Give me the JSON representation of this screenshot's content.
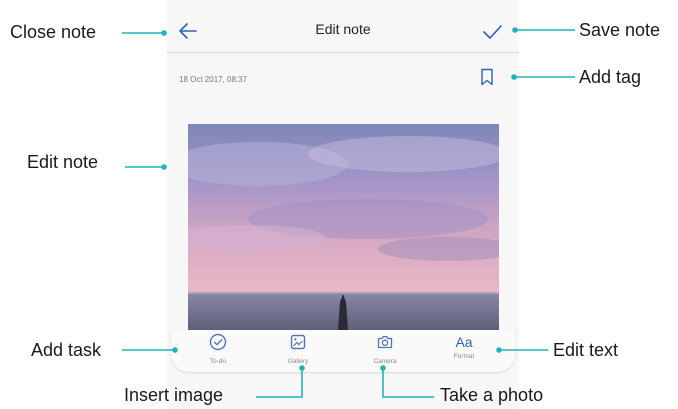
{
  "header": {
    "title": "Edit note",
    "back_icon": "arrow-left-icon",
    "save_icon": "checkmark-icon"
  },
  "note": {
    "timestamp": "18 Oct 2017, 08:37",
    "tag_icon": "bookmark-icon",
    "image": "sunset-sea-photo"
  },
  "toolbar": {
    "items": [
      {
        "icon": "todo-check-circle-icon",
        "label": "To-do"
      },
      {
        "icon": "gallery-image-icon",
        "label": "Gallery"
      },
      {
        "icon": "camera-icon",
        "label": "Camera"
      },
      {
        "icon": "format-text-icon",
        "label": "Format",
        "glyph": "Aa"
      }
    ]
  },
  "callouts": {
    "close_note": "Close note",
    "save_note": "Save note",
    "add_tag": "Add tag",
    "edit_note": "Edit note",
    "add_task": "Add task",
    "edit_text": "Edit text",
    "insert_image": "Insert image",
    "take_photo": "Take a photo"
  },
  "colors": {
    "accent": "#2f63b3",
    "leader_line": "#1fb5b8",
    "icon_gray": "#5a7fb5"
  }
}
